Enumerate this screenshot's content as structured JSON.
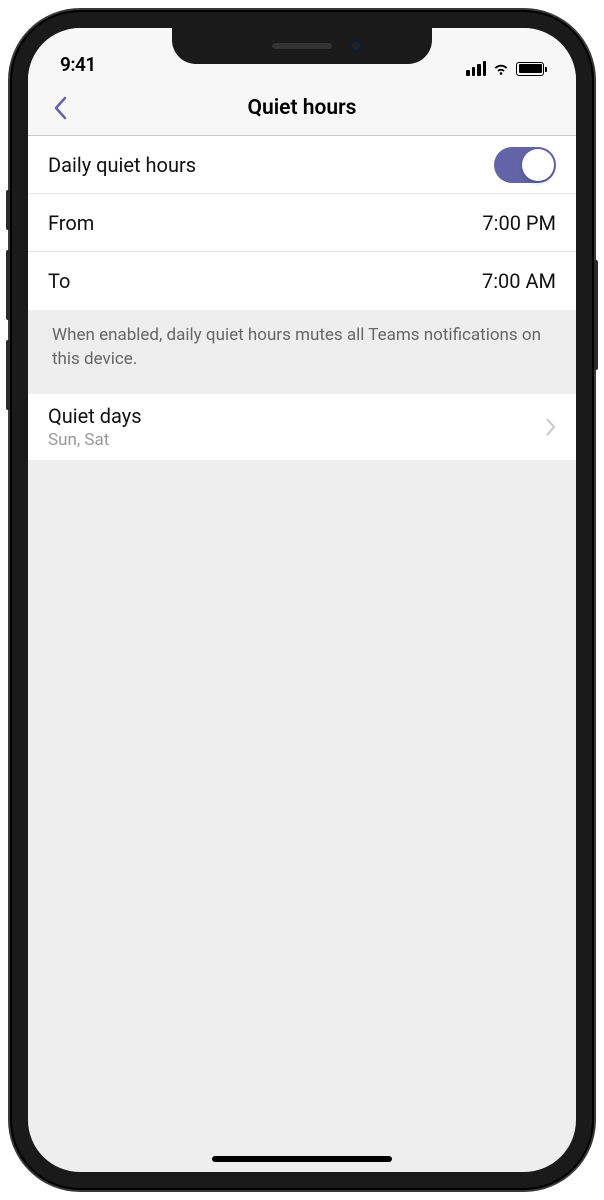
{
  "status": {
    "time": "9:41"
  },
  "header": {
    "title": "Quiet hours"
  },
  "dailyQuiet": {
    "label": "Daily quiet hours",
    "enabled": true,
    "from": {
      "label": "From",
      "value": "7:00 PM"
    },
    "to": {
      "label": "To",
      "value": "7:00 AM"
    },
    "description": "When enabled, daily quiet hours mutes all Teams notifications on this device."
  },
  "quietDays": {
    "label": "Quiet days",
    "value": "Sun, Sat"
  }
}
